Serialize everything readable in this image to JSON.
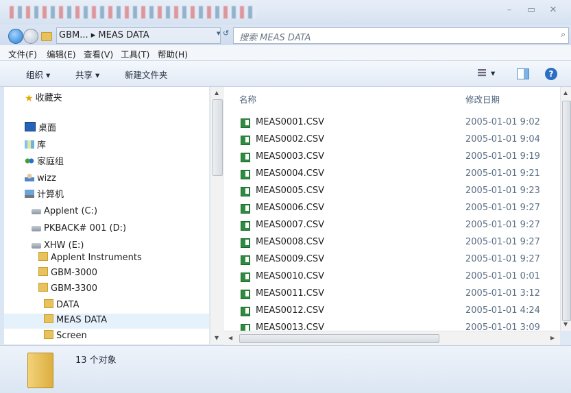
{
  "titlebar": {
    "minimize": "–",
    "maximize": "▭",
    "close": "✕"
  },
  "address": {
    "crumb1": "GBM...",
    "sep": "▸",
    "crumb2": "MEAS DATA",
    "refresh": "▾ ↺"
  },
  "search": {
    "placeholder": "搜索 MEAS DATA",
    "icon": "⌕"
  },
  "menu": {
    "file": "文件(F)",
    "edit": "编辑(E)",
    "view": "查看(V)",
    "tools": "工具(T)",
    "help": "帮助(H)"
  },
  "toolbar": {
    "organize": "组织 ▾",
    "share": "共享 ▾",
    "new_folder": "新建文件夹",
    "view_arrow": "▾",
    "help": "?"
  },
  "nav": {
    "favorites": "收藏夹",
    "desktop": "桌面",
    "libraries": "库",
    "homegroup": "家庭组",
    "user": "wizz",
    "computer": "计算机",
    "drive_c": "Applent (C:)",
    "drive_d": "PKBACK# 001 (D:)",
    "drive_e": "XHW (E:)",
    "folder_applent": "Applent Instruments",
    "folder_gbm3000": "GBM-3000",
    "folder_gbm3300": "GBM-3300",
    "folder_data": "DATA",
    "folder_meas": "MEAS DATA",
    "folder_screen": "Screen"
  },
  "columns": {
    "name": "名称",
    "date": "修改日期"
  },
  "files": [
    {
      "name": "MEAS0001.CSV",
      "date": "2005-01-01 9:02"
    },
    {
      "name": "MEAS0002.CSV",
      "date": "2005-01-01 9:04"
    },
    {
      "name": "MEAS0003.CSV",
      "date": "2005-01-01 9:19"
    },
    {
      "name": "MEAS0004.CSV",
      "date": "2005-01-01 9:21"
    },
    {
      "name": "MEAS0005.CSV",
      "date": "2005-01-01 9:23"
    },
    {
      "name": "MEAS0006.CSV",
      "date": "2005-01-01 9:27"
    },
    {
      "name": "MEAS0007.CSV",
      "date": "2005-01-01 9:27"
    },
    {
      "name": "MEAS0008.CSV",
      "date": "2005-01-01 9:27"
    },
    {
      "name": "MEAS0009.CSV",
      "date": "2005-01-01 9:27"
    },
    {
      "name": "MEAS0010.CSV",
      "date": "2005-01-01 0:01"
    },
    {
      "name": "MEAS0011.CSV",
      "date": "2005-01-01 3:12"
    },
    {
      "name": "MEAS0012.CSV",
      "date": "2005-01-01 4:24"
    },
    {
      "name": "MEAS0013.CSV",
      "date": "2005-01-01 3:09"
    }
  ],
  "status": {
    "count": "13 个对象"
  }
}
